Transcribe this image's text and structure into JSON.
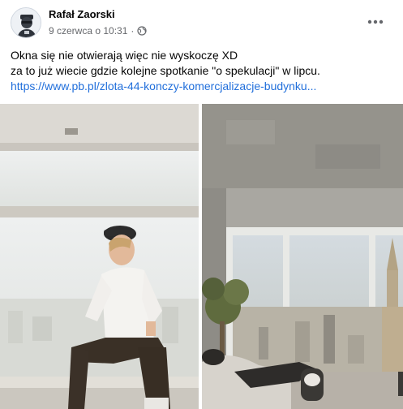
{
  "post": {
    "author": "Rafał Zaorski",
    "date": "9 czerwca o 10:31",
    "separator": "·",
    "privacy_icon": "globe-icon",
    "more_icon": "more-options-icon",
    "text_line_1": "Okna się nie otwierają więc nie wyskoczę XD",
    "text_line_2": "za to już wiecie gdzie kolejne spotkanie \"o spekulacji\"  w lipcu.",
    "link": "https://www.pb.pl/zlota-44-konczy-komercjalizacje-budynku..."
  },
  "colors": {
    "link": "#216fdb",
    "secondary_text": "#65676b",
    "primary_text": "#050505"
  }
}
